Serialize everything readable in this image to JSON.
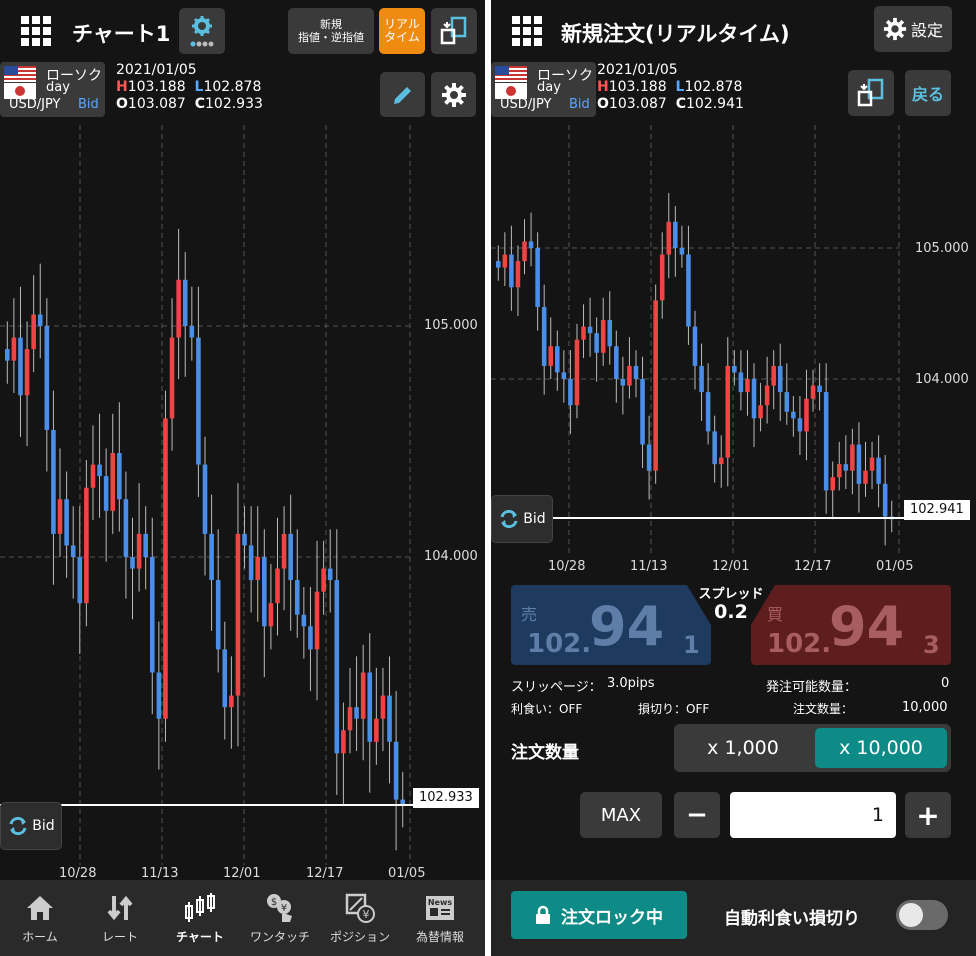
{
  "left": {
    "header": {
      "title": "チャート1",
      "new_order_label_1": "新規",
      "new_order_label_2": "指値・逆指値",
      "realtime_label_1": "リアル",
      "realtime_label_2": "タイム"
    },
    "info": {
      "chart_type": "ローソク",
      "period": "day",
      "pair": "USD/JPY",
      "side": "Bid",
      "date": "2021/01/05",
      "high_prefix": "H",
      "high": "103.188",
      "low_prefix": "L",
      "low": "102.878",
      "open_prefix": "O",
      "open": "103.087",
      "close_prefix": "C",
      "close": "102.933"
    },
    "current_price": "102.933",
    "bid_button": "Bid",
    "nav": [
      {
        "label": "ホーム",
        "icon": "home-icon"
      },
      {
        "label": "レート",
        "icon": "rate-icon"
      },
      {
        "label": "チャート",
        "icon": "chart-icon"
      },
      {
        "label": "ワンタッチ",
        "icon": "one-touch-icon"
      },
      {
        "label": "ポジション",
        "icon": "position-icon"
      },
      {
        "label": "為替情報",
        "icon": "news-icon"
      }
    ],
    "chart_data": {
      "type": "candlestick",
      "y_ticks": [
        "105.000",
        "104.000"
      ],
      "x_ticks": [
        "10/28",
        "11/13",
        "12/01",
        "12/17",
        "01/05"
      ]
    }
  },
  "right": {
    "header": {
      "title": "新規注文(リアルタイム)",
      "settings_label": "設定",
      "back_label": "戻る"
    },
    "info": {
      "chart_type": "ローソク",
      "period": "day",
      "pair": "USD/JPY",
      "side": "Bid",
      "date": "2021/01/05",
      "high_prefix": "H",
      "high": "103.188",
      "low_prefix": "L",
      "low": "102.878",
      "open_prefix": "O",
      "open": "103.087",
      "close_prefix": "C",
      "close": "102.941"
    },
    "current_price": "102.941",
    "bid_button": "Bid",
    "chart_data": {
      "type": "candlestick",
      "y_ticks": [
        "105.000",
        "104.000"
      ],
      "x_ticks": [
        "10/28",
        "11/13",
        "12/01",
        "12/17",
        "01/05"
      ]
    },
    "spread_label": "スプレッド",
    "spread_value": "0.2",
    "sell": {
      "label": "売",
      "small": "102.",
      "big": "94",
      "sub": "1"
    },
    "buy": {
      "label": "買",
      "small": "102.",
      "big": "94",
      "sub": "3"
    },
    "slippage_label": "スリッページ：",
    "slippage_value": "3.0pips",
    "available_label": "発注可能数量：",
    "available_value": "0",
    "take_profit": "利食い：OFF",
    "stop_loss": "損切り：OFF",
    "order_qty_label_small": "注文数量：",
    "order_qty_value": "10,000",
    "qty_label": "注文数量",
    "unit_1000": "x 1,000",
    "unit_10000": "x 10,000",
    "max_label": "MAX",
    "minus": "−",
    "plus": "+",
    "qty_input": "1",
    "lock_label": "注文ロック中",
    "auto_label": "自動利食い損切り"
  }
}
